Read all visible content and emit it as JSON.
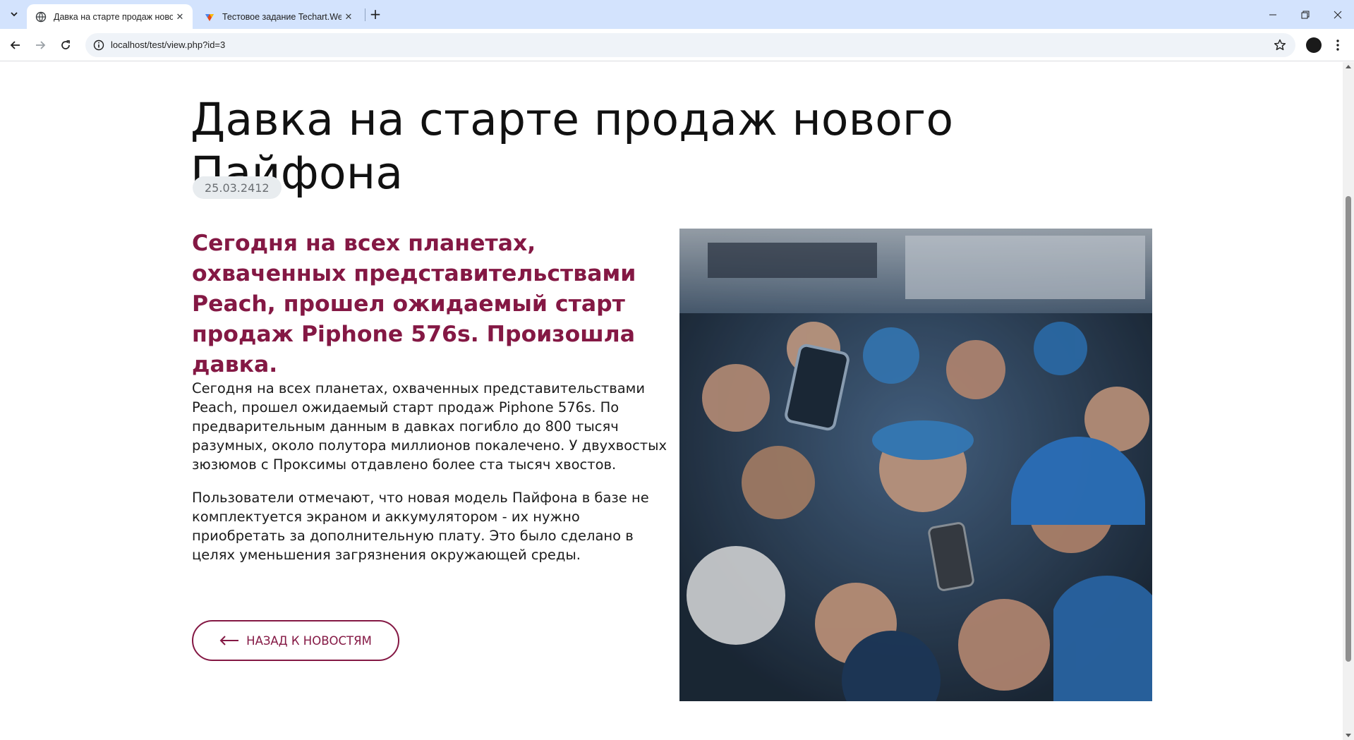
{
  "browser": {
    "tabs": [
      {
        "title": "Давка на старте продаж нового Пайфона",
        "active": true
      },
      {
        "title": "Тестовое задание Techart.Web",
        "active": false
      }
    ],
    "url": "localhost/test/view.php?id=3"
  },
  "article": {
    "title": "Давка на старте продаж нового Пайфона",
    "date": "25.03.2412",
    "lead": "Сегодня на всех планетах, охваченных представительствами Peach, прошел ожидаемый старт продаж Piphone 576s. Произошла давка.",
    "paragraphs": [
      "Сегодня на всех планетах, охваченных представительствами Peach, прошел ожидаемый старт продаж Piphone 576s. По предварительным данным в давках погибло до 800 тысяч разумных, около полутора миллионов покалечено. У двухвостых зюзюмов с Проксимы отдавлено более ста тысяч хвостов.",
      "Пользователи отмечают, что новая модель Пайфона в базе не комплектуется экраном и аккумулятором - их нужно приобретать за дополнительную плату. Это было сделано в целях уменьшения загрязнения окружающей среды."
    ],
    "back_label": "НАЗАД К НОВОСТЯМ"
  },
  "colors": {
    "accent": "#841844",
    "tabstrip": "#d3e3fd",
    "date_badge_bg": "#e8ecef"
  },
  "icons": {
    "tab_list": "chevron-down-icon",
    "back": "arrow-left-icon",
    "forward": "arrow-right-icon",
    "reload": "reload-icon",
    "site_info": "info-icon",
    "bookmark": "star-icon",
    "menu": "kebab-menu-icon"
  }
}
